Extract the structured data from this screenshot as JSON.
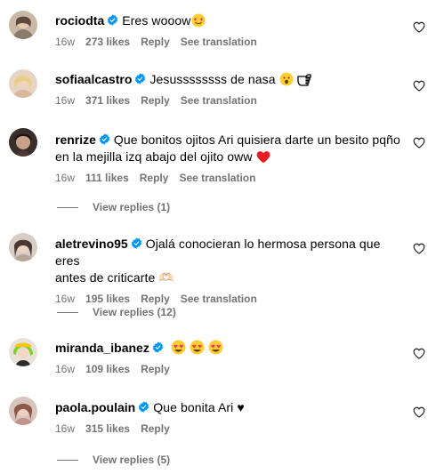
{
  "comments": [
    {
      "username": "rociodta",
      "text": "Eres wooow",
      "emojis": [
        "heart-eyes-smiley-emoji"
      ],
      "age": "16w",
      "likes": "273 likes",
      "reply": "Reply",
      "translate": "See translation"
    },
    {
      "username": "sofiaalcastro",
      "text": "Jesussssssss de nasa",
      "emojis": [
        "surprised-face-emoji",
        "pointing-hand-emoji"
      ],
      "age": "16w",
      "likes": "371 likes",
      "reply": "Reply",
      "translate": "See translation"
    },
    {
      "username": "renrize",
      "text_line1": "Que bonitos ojitos Ari quisiera darte un besito pqño",
      "text_line2": "en la mejilla izq abajo del ojito oww",
      "emojis": [
        "red-heart-emoji"
      ],
      "age": "16w",
      "likes": "111 likes",
      "reply": "Reply",
      "translate": "See translation",
      "view_replies": "View replies (1)"
    },
    {
      "username": "aletrevino95",
      "text_line1": "Ojalá conocieran lo hermosa persona que eres",
      "text_line2": "antes de criticarte 🫶🏻",
      "age": "16w",
      "likes": "195 likes",
      "reply": "Reply",
      "translate": "See translation",
      "view_replies": "View replies (12)"
    },
    {
      "username": "miranda_ibanez",
      "emojis": [
        "heart-eyes-emoji",
        "heart-eyes-emoji",
        "heart-eyes-emoji"
      ],
      "age": "16w",
      "likes": "109 likes",
      "reply": "Reply"
    },
    {
      "username": "paola.poulain",
      "text": "Que bonita Ari ♥",
      "age": "16w",
      "likes": "315 likes",
      "reply": "Reply",
      "view_replies": "View replies (5)"
    }
  ],
  "colors": {
    "verified": "#0095f6",
    "meta": "#737373",
    "heart_red": "#ed1c24",
    "emoji_yellow": "#ffcc33"
  }
}
